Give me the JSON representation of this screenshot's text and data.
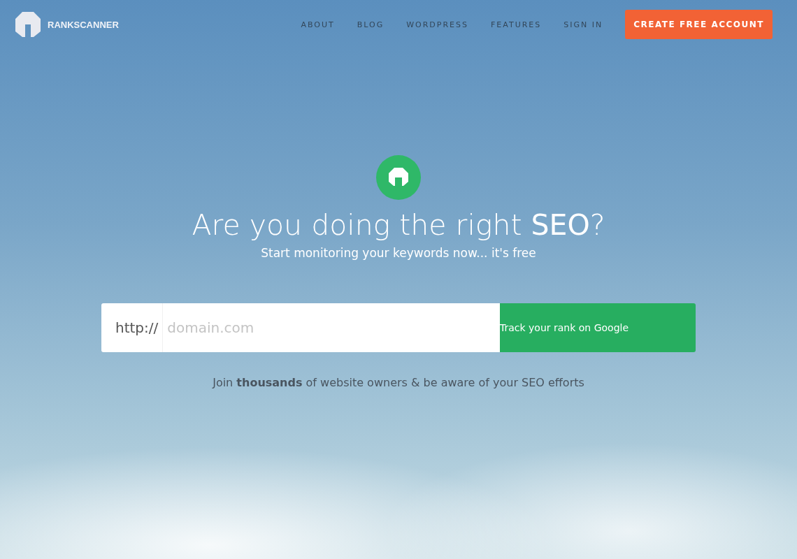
{
  "logo": {
    "text": "RANKSCANNER"
  },
  "nav": {
    "links": [
      "ABOUT",
      "BLOG",
      "WORDPRESS",
      "FEATURES",
      "SIGN IN"
    ],
    "cta": "CREATE FREE ACCOUNT"
  },
  "hero": {
    "title": "Are you doing the right **SEO**?",
    "subtitle": "Start monitoring your keywords now... it's free",
    "form": {
      "prefix": "http://",
      "placeholder": "domain.com",
      "button": "Track your rank on Google"
    },
    "note": "Join **thousands** of website owners & be aware of your SEO efforts"
  }
}
